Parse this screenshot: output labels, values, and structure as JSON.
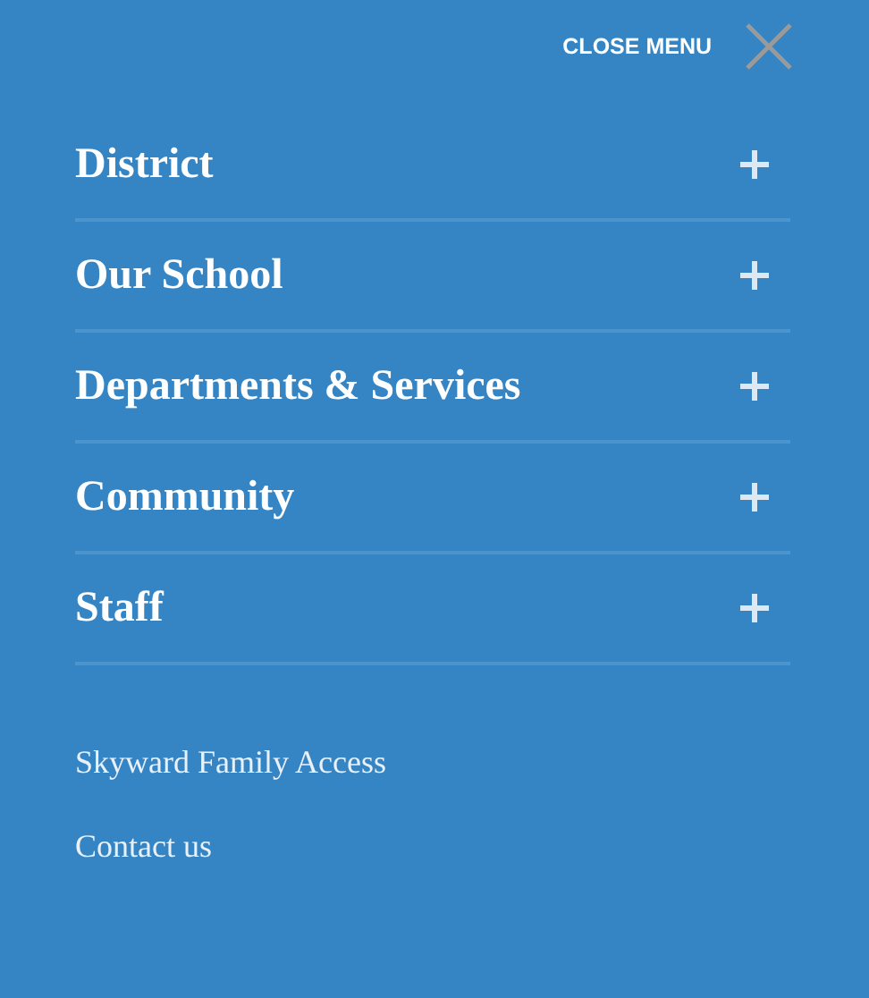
{
  "close_menu": {
    "label": "CLOSE MENU"
  },
  "menu_items": [
    {
      "label": "District",
      "expanded": false
    },
    {
      "label": "Our School",
      "expanded": false
    },
    {
      "label": "Departments & Services",
      "expanded": false
    },
    {
      "label": "Community",
      "expanded": false
    },
    {
      "label": "Staff",
      "expanded": false
    }
  ],
  "links": [
    "Skyward Family Access",
    "Contact us"
  ]
}
